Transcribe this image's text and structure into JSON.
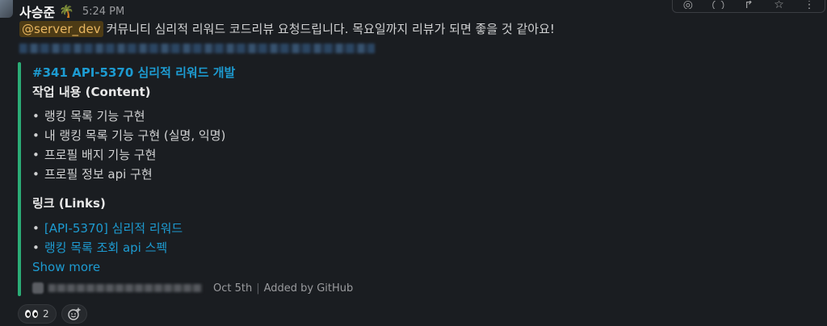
{
  "message": {
    "author": "사승준",
    "author_emoji": "🌴",
    "time": "5:24 PM",
    "mention": "@server_dev",
    "text": "커뮤니티 심리적 리워드 코드리뷰 요청드립니다. 목요일까지 리뷰가 되면 좋을 것 같아요!"
  },
  "toolbar": {
    "icons": [
      "emoji-react-icon",
      "reply-thread-icon",
      "forward-icon",
      "bookmark-star-icon",
      "more-icon"
    ]
  },
  "attachment": {
    "accent_color": "#2bac76",
    "title": "#341 API-5370 심리적 리워드 개발",
    "content_heading": "작업 내용 (Content)",
    "content_items": [
      "랭킹 목록 기능 구현",
      "내 랭킹 목록 기능 구현 (실명, 익명)",
      "프로필 배지 기능 구현",
      "프로필 정보 api 구현"
    ],
    "links_heading": "링크 (Links)",
    "links": [
      "[API-5370] 심리적 리워드",
      "랭킹 목록 조회 api 스펙"
    ],
    "show_more": "Show more",
    "footer_date": "Oct 5th",
    "footer_source": "Added by GitHub"
  },
  "reactions": [
    {
      "emoji": "eyes-icon",
      "count": "2"
    }
  ],
  "colors": {
    "background": "#1a1d21",
    "link": "#1d9bd1",
    "mention_bg": "#4d3b15",
    "mention_text": "#e8b661"
  }
}
